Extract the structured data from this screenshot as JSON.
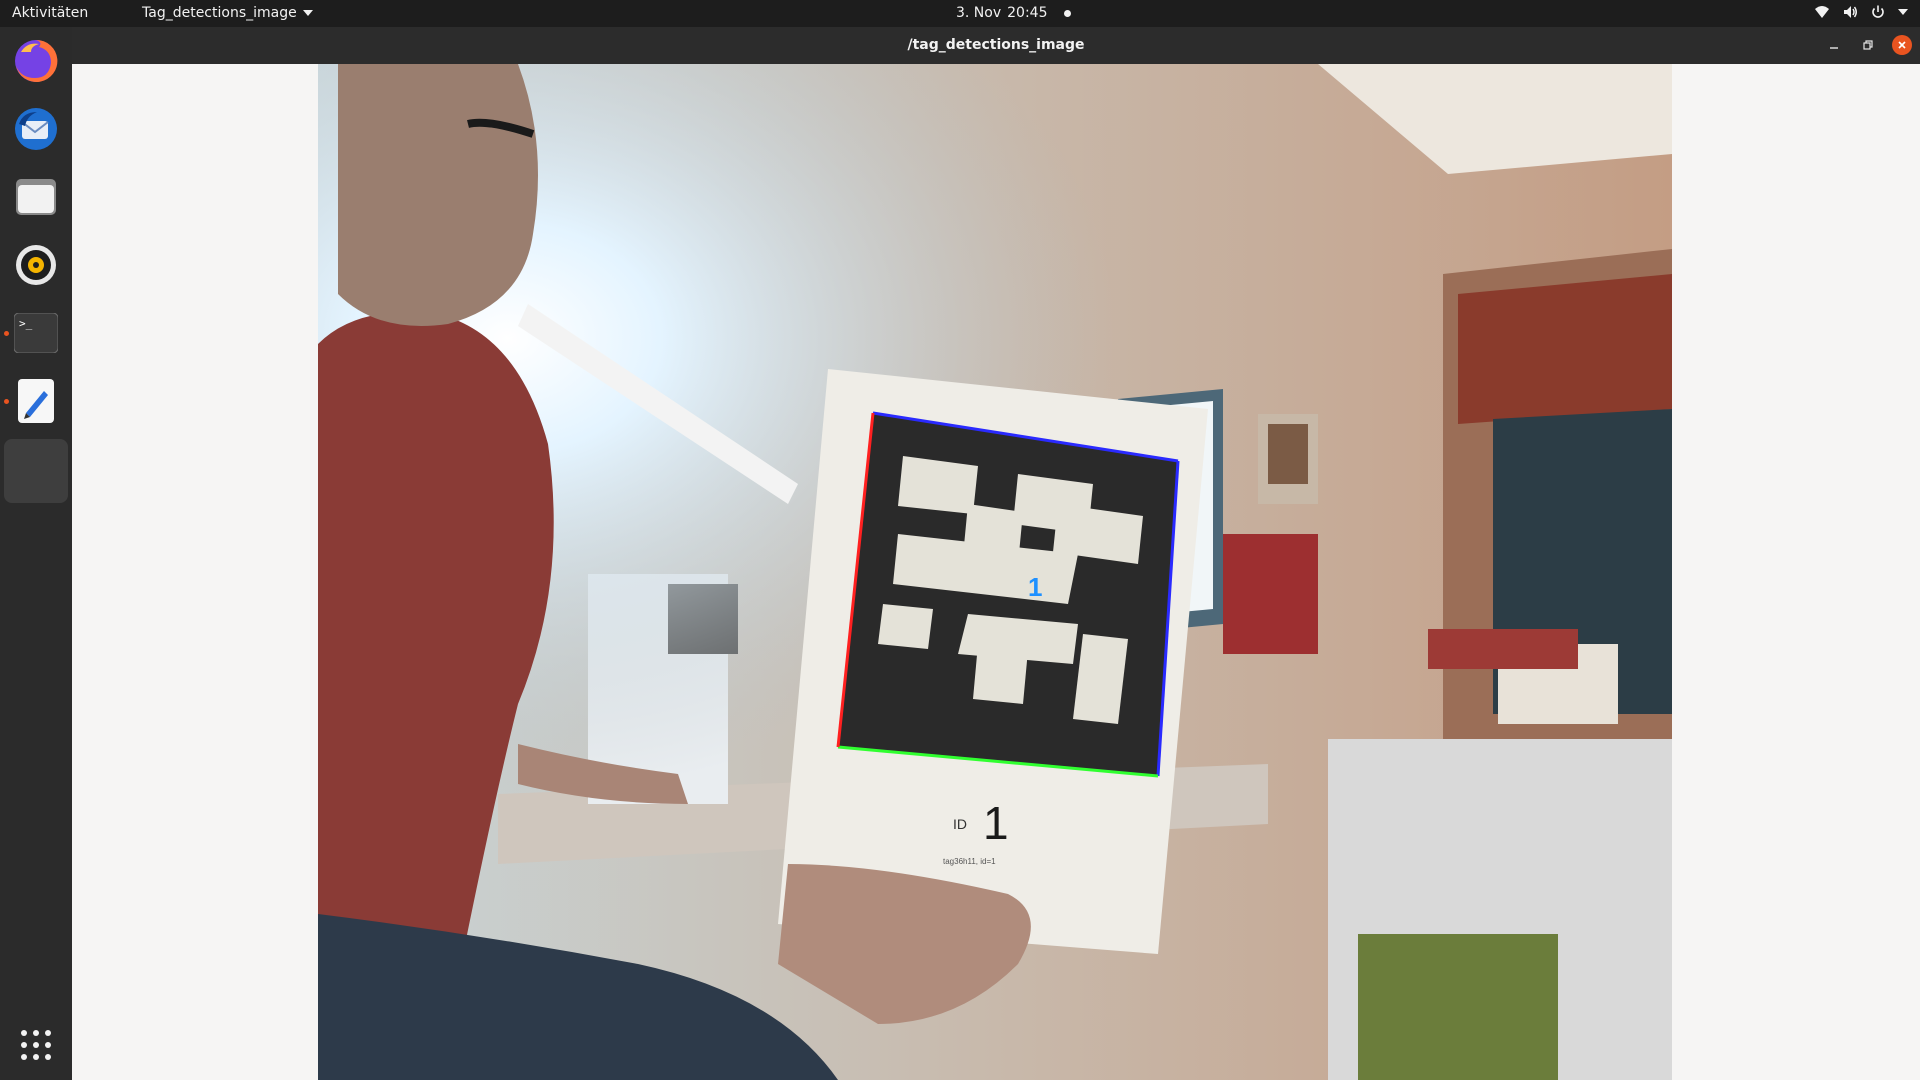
{
  "topbar": {
    "activities": "Aktivitäten",
    "app_menu": "Tag_detections_image",
    "date": "3. Nov",
    "time": "20:45"
  },
  "dock": {
    "items": [
      {
        "icon": "firefox-icon",
        "running": false
      },
      {
        "icon": "thunderbird-icon",
        "running": false
      },
      {
        "icon": "files-icon",
        "running": false
      },
      {
        "icon": "rhythmbox-icon",
        "running": false
      },
      {
        "icon": "terminal-icon",
        "running": true
      },
      {
        "icon": "text-editor-icon",
        "running": true
      },
      {
        "icon": "blank-app-icon",
        "running": true,
        "active": true
      }
    ],
    "show_apps_icon": "grid-icon"
  },
  "window": {
    "title": "/tag_detections_image",
    "controls": [
      "minimize",
      "maximize",
      "close"
    ]
  },
  "camera": {
    "tag_id_overlay": "1",
    "paper_label": "ID",
    "paper_id": "1",
    "paper_caption": "tag36h11, id=1",
    "colors": {
      "tag_top_edge": "#2a2aff",
      "tag_left_edge": "#ff2020",
      "tag_bottom_edge": "#30ff30",
      "tag_right_edge": "#2a2aff",
      "overlay_text": "#1e90ff"
    }
  }
}
